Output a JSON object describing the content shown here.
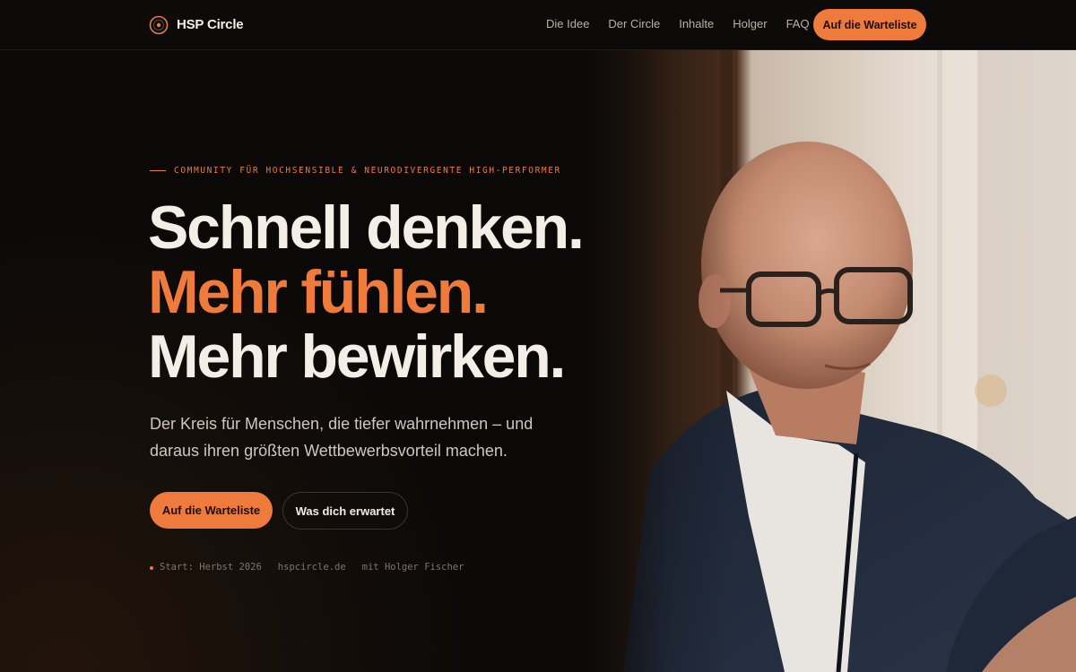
{
  "nav": {
    "brand": "HSP Circle",
    "links": [
      {
        "label": "Die Idee"
      },
      {
        "label": "Der Circle"
      },
      {
        "label": "Inhalte"
      },
      {
        "label": "Holger"
      },
      {
        "label": "FAQ"
      }
    ],
    "cta": "Auf die Warteliste"
  },
  "hero": {
    "eyebrow": "COMMUNITY FÜR HOCHSENSIBLE & NEURODIVERGENTE HIGH-PERFORMER",
    "headline": [
      "Schnell denken.",
      "Mehr fühlen.",
      "Mehr bewirken."
    ],
    "subline": "Der Kreis für Menschen, die tiefer wahrnehmen – und daraus ihren größten Wettbewerbsvorteil machen.",
    "primary_button": "Auf die Warteliste",
    "secondary_button": "Was dich erwartet",
    "meta": [
      "Start: Herbst 2026",
      "hspcircle.de",
      "mit Holger Fischer"
    ]
  },
  "colors": {
    "accent": "#ee7a3c",
    "background": "#0a0908",
    "text": "#f4efe6"
  },
  "icons": {
    "brand": "circle-target-logo"
  }
}
